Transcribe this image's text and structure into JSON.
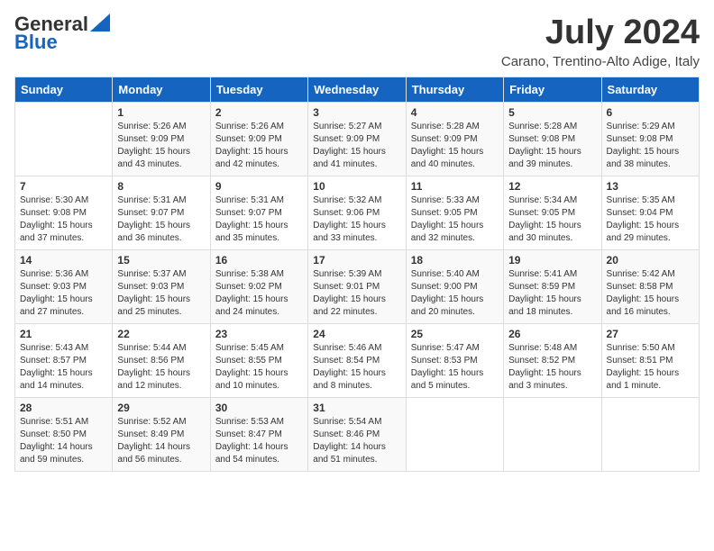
{
  "header": {
    "logo_line1": "General",
    "logo_line2": "Blue",
    "month_title": "July 2024",
    "location": "Carano, Trentino-Alto Adige, Italy"
  },
  "days_of_week": [
    "Sunday",
    "Monday",
    "Tuesday",
    "Wednesday",
    "Thursday",
    "Friday",
    "Saturday"
  ],
  "weeks": [
    [
      {
        "day": "",
        "content": ""
      },
      {
        "day": "1",
        "content": "Sunrise: 5:26 AM\nSunset: 9:09 PM\nDaylight: 15 hours\nand 43 minutes."
      },
      {
        "day": "2",
        "content": "Sunrise: 5:26 AM\nSunset: 9:09 PM\nDaylight: 15 hours\nand 42 minutes."
      },
      {
        "day": "3",
        "content": "Sunrise: 5:27 AM\nSunset: 9:09 PM\nDaylight: 15 hours\nand 41 minutes."
      },
      {
        "day": "4",
        "content": "Sunrise: 5:28 AM\nSunset: 9:09 PM\nDaylight: 15 hours\nand 40 minutes."
      },
      {
        "day": "5",
        "content": "Sunrise: 5:28 AM\nSunset: 9:08 PM\nDaylight: 15 hours\nand 39 minutes."
      },
      {
        "day": "6",
        "content": "Sunrise: 5:29 AM\nSunset: 9:08 PM\nDaylight: 15 hours\nand 38 minutes."
      }
    ],
    [
      {
        "day": "7",
        "content": "Sunrise: 5:30 AM\nSunset: 9:08 PM\nDaylight: 15 hours\nand 37 minutes."
      },
      {
        "day": "8",
        "content": "Sunrise: 5:31 AM\nSunset: 9:07 PM\nDaylight: 15 hours\nand 36 minutes."
      },
      {
        "day": "9",
        "content": "Sunrise: 5:31 AM\nSunset: 9:07 PM\nDaylight: 15 hours\nand 35 minutes."
      },
      {
        "day": "10",
        "content": "Sunrise: 5:32 AM\nSunset: 9:06 PM\nDaylight: 15 hours\nand 33 minutes."
      },
      {
        "day": "11",
        "content": "Sunrise: 5:33 AM\nSunset: 9:05 PM\nDaylight: 15 hours\nand 32 minutes."
      },
      {
        "day": "12",
        "content": "Sunrise: 5:34 AM\nSunset: 9:05 PM\nDaylight: 15 hours\nand 30 minutes."
      },
      {
        "day": "13",
        "content": "Sunrise: 5:35 AM\nSunset: 9:04 PM\nDaylight: 15 hours\nand 29 minutes."
      }
    ],
    [
      {
        "day": "14",
        "content": "Sunrise: 5:36 AM\nSunset: 9:03 PM\nDaylight: 15 hours\nand 27 minutes."
      },
      {
        "day": "15",
        "content": "Sunrise: 5:37 AM\nSunset: 9:03 PM\nDaylight: 15 hours\nand 25 minutes."
      },
      {
        "day": "16",
        "content": "Sunrise: 5:38 AM\nSunset: 9:02 PM\nDaylight: 15 hours\nand 24 minutes."
      },
      {
        "day": "17",
        "content": "Sunrise: 5:39 AM\nSunset: 9:01 PM\nDaylight: 15 hours\nand 22 minutes."
      },
      {
        "day": "18",
        "content": "Sunrise: 5:40 AM\nSunset: 9:00 PM\nDaylight: 15 hours\nand 20 minutes."
      },
      {
        "day": "19",
        "content": "Sunrise: 5:41 AM\nSunset: 8:59 PM\nDaylight: 15 hours\nand 18 minutes."
      },
      {
        "day": "20",
        "content": "Sunrise: 5:42 AM\nSunset: 8:58 PM\nDaylight: 15 hours\nand 16 minutes."
      }
    ],
    [
      {
        "day": "21",
        "content": "Sunrise: 5:43 AM\nSunset: 8:57 PM\nDaylight: 15 hours\nand 14 minutes."
      },
      {
        "day": "22",
        "content": "Sunrise: 5:44 AM\nSunset: 8:56 PM\nDaylight: 15 hours\nand 12 minutes."
      },
      {
        "day": "23",
        "content": "Sunrise: 5:45 AM\nSunset: 8:55 PM\nDaylight: 15 hours\nand 10 minutes."
      },
      {
        "day": "24",
        "content": "Sunrise: 5:46 AM\nSunset: 8:54 PM\nDaylight: 15 hours\nand 8 minutes."
      },
      {
        "day": "25",
        "content": "Sunrise: 5:47 AM\nSunset: 8:53 PM\nDaylight: 15 hours\nand 5 minutes."
      },
      {
        "day": "26",
        "content": "Sunrise: 5:48 AM\nSunset: 8:52 PM\nDaylight: 15 hours\nand 3 minutes."
      },
      {
        "day": "27",
        "content": "Sunrise: 5:50 AM\nSunset: 8:51 PM\nDaylight: 15 hours\nand 1 minute."
      }
    ],
    [
      {
        "day": "28",
        "content": "Sunrise: 5:51 AM\nSunset: 8:50 PM\nDaylight: 14 hours\nand 59 minutes."
      },
      {
        "day": "29",
        "content": "Sunrise: 5:52 AM\nSunset: 8:49 PM\nDaylight: 14 hours\nand 56 minutes."
      },
      {
        "day": "30",
        "content": "Sunrise: 5:53 AM\nSunset: 8:47 PM\nDaylight: 14 hours\nand 54 minutes."
      },
      {
        "day": "31",
        "content": "Sunrise: 5:54 AM\nSunset: 8:46 PM\nDaylight: 14 hours\nand 51 minutes."
      },
      {
        "day": "",
        "content": ""
      },
      {
        "day": "",
        "content": ""
      },
      {
        "day": "",
        "content": ""
      }
    ]
  ]
}
